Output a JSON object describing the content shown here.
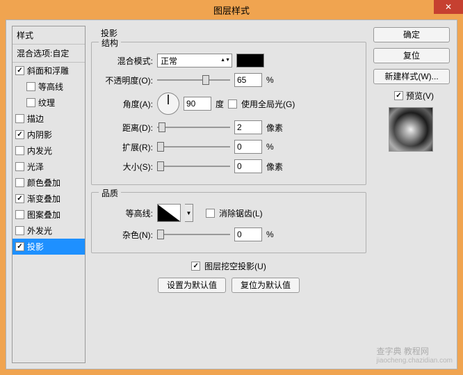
{
  "title": "图层样式",
  "left": {
    "header1": "样式",
    "header2": "混合选项:自定",
    "items": [
      {
        "label": "斜面和浮雕",
        "checked": true,
        "sub": false
      },
      {
        "label": "等高线",
        "checked": false,
        "sub": true
      },
      {
        "label": "纹理",
        "checked": false,
        "sub": true
      },
      {
        "label": "描边",
        "checked": false,
        "sub": false
      },
      {
        "label": "内阴影",
        "checked": true,
        "sub": false
      },
      {
        "label": "内发光",
        "checked": false,
        "sub": false
      },
      {
        "label": "光泽",
        "checked": false,
        "sub": false
      },
      {
        "label": "颜色叠加",
        "checked": false,
        "sub": false
      },
      {
        "label": "渐变叠加",
        "checked": true,
        "sub": false
      },
      {
        "label": "图案叠加",
        "checked": false,
        "sub": false
      },
      {
        "label": "外发光",
        "checked": false,
        "sub": false
      },
      {
        "label": "投影",
        "checked": true,
        "sub": false,
        "selected": true
      }
    ]
  },
  "right": {
    "ok": "确定",
    "cancel": "复位",
    "newStyle": "新建样式(W)...",
    "preview": "预览(V)",
    "previewChecked": true
  },
  "mid": {
    "sectionTitle": "投影",
    "group1": {
      "title": "结构",
      "blendMode": {
        "label": "混合模式:",
        "value": "正常"
      },
      "opacity": {
        "label": "不透明度(O):",
        "value": "65",
        "unit": "%",
        "thumb": 62
      },
      "angle": {
        "label": "角度(A):",
        "value": "90",
        "unit": "度",
        "global": "使用全局光(G)",
        "globalChecked": false
      },
      "distance": {
        "label": "距离(D):",
        "value": "2",
        "unit": "像素",
        "thumb": 2
      },
      "spread": {
        "label": "扩展(R):",
        "value": "0",
        "unit": "%",
        "thumb": 0
      },
      "size": {
        "label": "大小(S):",
        "value": "0",
        "unit": "像素",
        "thumb": 0
      }
    },
    "group2": {
      "title": "品质",
      "contour": {
        "label": "等高线:",
        "antialias": "消除锯齿(L)",
        "aaChecked": false
      },
      "noise": {
        "label": "杂色(N):",
        "value": "0",
        "unit": "%",
        "thumb": 0
      }
    },
    "knockout": {
      "label": "图层挖空投影(U)",
      "checked": true
    },
    "btnDefault": "设置为默认值",
    "btnReset": "复位为默认值"
  },
  "watermark": {
    "main": "查字典 教程网",
    "sub": "jiaocheng.chazidian.com"
  }
}
